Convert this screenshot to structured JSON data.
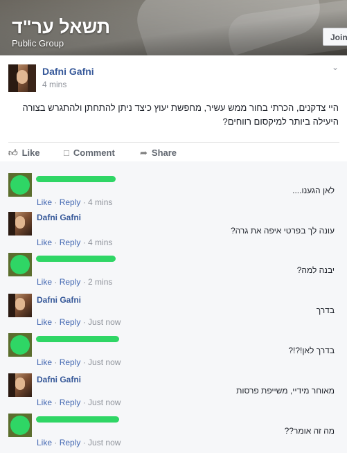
{
  "group": {
    "name": "תשאל ער\"ד",
    "type": "Public Group",
    "join_label": "Join"
  },
  "post": {
    "author": "Dafni Gafni",
    "time": "4 mins",
    "text": "היי צדקנים, הכרתי בחור ממש עשיר, מחפשת יעוץ כיצד ניתן להתחתן ולהתגרש בצורה היעילה ביותר למיקסום רווחים?",
    "actions": {
      "like": "Like",
      "comment": "Comment",
      "share": "Share"
    },
    "icons": {
      "like": "thumbs-up-icon",
      "comment": "speech-bubble-icon",
      "share": "share-arrow-icon",
      "menu": "chevron-down-icon"
    }
  },
  "comments": [
    {
      "author": "",
      "text": "לאן הגענו....",
      "like": "Like",
      "reply": "Reply",
      "time": "4 mins"
    },
    {
      "author": "Dafni Gafni",
      "text": "עונה לך בפרטי איפה את גרה?",
      "like": "Like",
      "reply": "Reply",
      "time": "4 mins"
    },
    {
      "author": "",
      "text": "יבנה למה?",
      "like": "Like",
      "reply": "Reply",
      "time": "2 mins"
    },
    {
      "author": "Dafni Gafni",
      "text": "בדרך",
      "like": "Like",
      "reply": "Reply",
      "time": "Just now"
    },
    {
      "author": "",
      "text": "בדרך לאן!?!?",
      "like": "Like",
      "reply": "Reply",
      "time": "Just now"
    },
    {
      "author": "Dafni Gafni",
      "text": "מאוחר מידיי, משייפת פרסות",
      "like": "Like",
      "reply": "Reply",
      "time": "Just now"
    },
    {
      "author": "",
      "text": "מה זה אומר??",
      "like": "Like",
      "reply": "Reply",
      "time": "Just now"
    }
  ],
  "colors": {
    "link": "#365899",
    "redaction": "#2fd665",
    "meta": "#90949c",
    "comments_bg": "#f6f7f9"
  }
}
